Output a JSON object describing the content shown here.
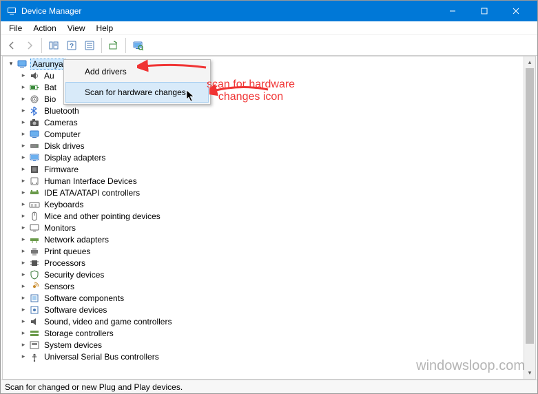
{
  "window": {
    "title": "Device Manager"
  },
  "menubar": {
    "items": [
      "File",
      "Action",
      "View",
      "Help"
    ]
  },
  "toolbar": {
    "icons": [
      "back",
      "forward",
      "show-hidden",
      "help",
      "properties",
      "update",
      "scan-hardware"
    ]
  },
  "tree": {
    "root": {
      "label": "Aarunya"
    },
    "children": [
      {
        "label": "Au",
        "icon": "audio"
      },
      {
        "label": "Bat",
        "icon": "battery"
      },
      {
        "label": "Bio",
        "icon": "biometric"
      },
      {
        "label": "Bluetooth",
        "icon": "bluetooth"
      },
      {
        "label": "Cameras",
        "icon": "camera"
      },
      {
        "label": "Computer",
        "icon": "computer"
      },
      {
        "label": "Disk drives",
        "icon": "disk"
      },
      {
        "label": "Display adapters",
        "icon": "display"
      },
      {
        "label": "Firmware",
        "icon": "firmware"
      },
      {
        "label": "Human Interface Devices",
        "icon": "hid"
      },
      {
        "label": "IDE ATA/ATAPI controllers",
        "icon": "ide"
      },
      {
        "label": "Keyboards",
        "icon": "keyboard"
      },
      {
        "label": "Mice and other pointing devices",
        "icon": "mouse"
      },
      {
        "label": "Monitors",
        "icon": "monitor"
      },
      {
        "label": "Network adapters",
        "icon": "network"
      },
      {
        "label": "Print queues",
        "icon": "printer"
      },
      {
        "label": "Processors",
        "icon": "cpu"
      },
      {
        "label": "Security devices",
        "icon": "security"
      },
      {
        "label": "Sensors",
        "icon": "sensor"
      },
      {
        "label": "Software components",
        "icon": "swcomponent"
      },
      {
        "label": "Software devices",
        "icon": "swdevice"
      },
      {
        "label": "Sound, video and game controllers",
        "icon": "sound"
      },
      {
        "label": "Storage controllers",
        "icon": "storage"
      },
      {
        "label": "System devices",
        "icon": "system"
      },
      {
        "label": "Universal Serial Bus controllers",
        "icon": "usb"
      }
    ]
  },
  "context_menu": {
    "items": [
      {
        "label": "Add drivers",
        "hover": false
      },
      {
        "label": "Scan for hardware changes",
        "hover": true
      }
    ]
  },
  "statusbar": {
    "text": "Scan for changed or new Plug and Play devices."
  },
  "annotation": {
    "line1": "scan for hardware",
    "line2": "changes icon"
  },
  "watermark": "windowsloop.com"
}
